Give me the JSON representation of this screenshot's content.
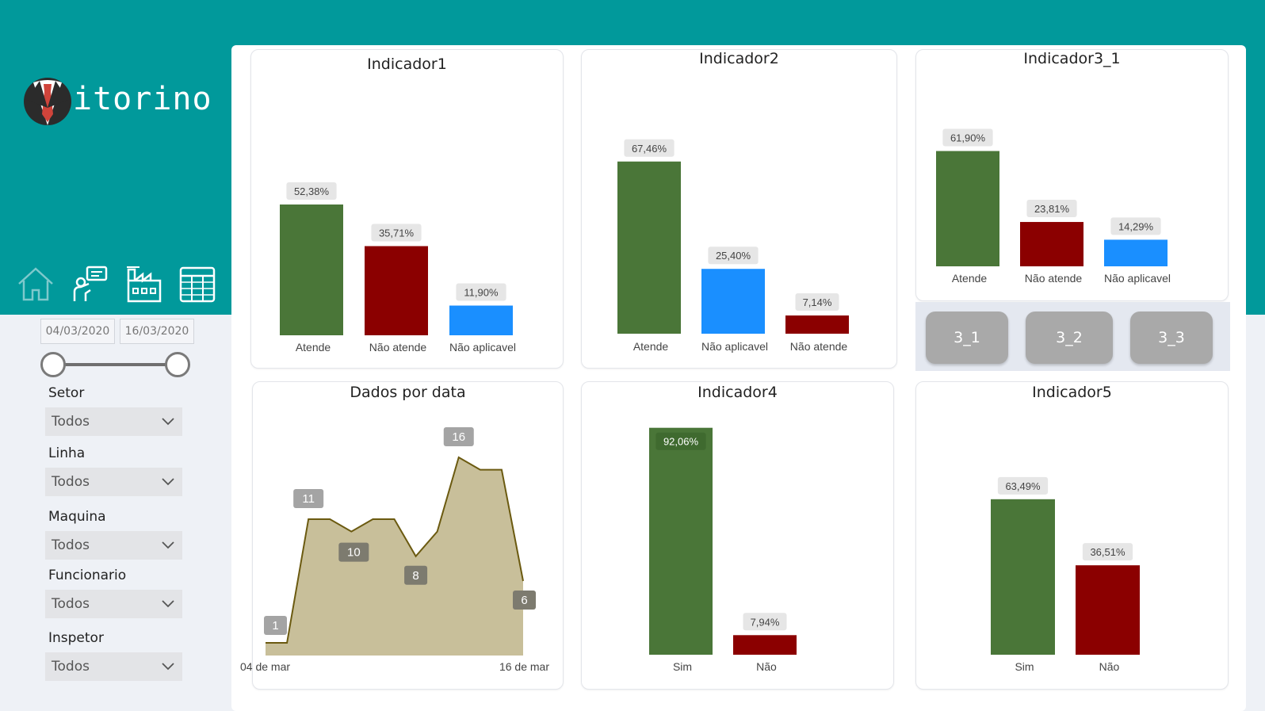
{
  "brand": {
    "name": "itorino"
  },
  "nav": [
    {
      "label": "home-icon"
    },
    {
      "label": "inspector-icon"
    },
    {
      "label": "factory-icon"
    },
    {
      "label": "table-icon"
    }
  ],
  "date_range": {
    "start": "04/03/2020",
    "end": "16/03/2020"
  },
  "filters": [
    {
      "label": "Setor",
      "value": "Todos"
    },
    {
      "label": "Linha",
      "value": "Todos"
    },
    {
      "label": "Maquina",
      "value": "Todos"
    },
    {
      "label": "Funcionario",
      "value": "Todos"
    },
    {
      "label": "Inspetor",
      "value": "Todos"
    }
  ],
  "colors": {
    "teal": "#01999b",
    "green": "#4a7638",
    "red": "#8b0000",
    "blue": "#1a8fff",
    "area_fill": "#c8bf9a",
    "area_line": "#6b5a10"
  },
  "sub_buttons": [
    "3_1",
    "3_2",
    "3_3"
  ],
  "chart_data": [
    {
      "type": "bar",
      "title": "Indicador1",
      "categories": [
        "Atende",
        "Não atende",
        "Não aplicavel"
      ],
      "values": [
        52.38,
        35.71,
        11.9
      ],
      "labels": [
        "52,38%",
        "35,71%",
        "11,90%"
      ],
      "colors": [
        "#4a7638",
        "#8b0000",
        "#1a8fff"
      ]
    },
    {
      "type": "bar",
      "title": "Indicador2",
      "categories": [
        "Atende",
        "Não aplicavel",
        "Não atende"
      ],
      "values": [
        67.46,
        25.4,
        7.14
      ],
      "labels": [
        "67,46%",
        "25,40%",
        "7,14%"
      ],
      "colors": [
        "#4a7638",
        "#1a8fff",
        "#8b0000"
      ]
    },
    {
      "type": "bar",
      "title": "Indicador3_1",
      "categories": [
        "Atende",
        "Não atende",
        "Não aplicavel"
      ],
      "values": [
        61.9,
        23.81,
        14.29
      ],
      "labels": [
        "61,90%",
        "23,81%",
        "14,29%"
      ],
      "colors": [
        "#4a7638",
        "#8b0000",
        "#1a8fff"
      ]
    },
    {
      "type": "area",
      "title": "Dados por data",
      "x_start_label": "04 de mar",
      "x_end_label": "16 de mar",
      "values": [
        1,
        1,
        11,
        11,
        10,
        11,
        11,
        8,
        10,
        16,
        15,
        15,
        6
      ],
      "data_labels": [
        {
          "index": 0,
          "text": "1"
        },
        {
          "index": 2,
          "text": "11"
        },
        {
          "index": 4,
          "text": "10"
        },
        {
          "index": 7,
          "text": "8"
        },
        {
          "index": 9,
          "text": "16"
        },
        {
          "index": 12,
          "text": "6"
        }
      ]
    },
    {
      "type": "bar",
      "title": "Indicador4",
      "categories": [
        "Sim",
        "Não"
      ],
      "values": [
        92.06,
        7.94
      ],
      "labels": [
        "92,06%",
        "7,94%"
      ],
      "colors": [
        "#4a7638",
        "#8b0000"
      ]
    },
    {
      "type": "bar",
      "title": "Indicador5",
      "categories": [
        "Sim",
        "Não"
      ],
      "values": [
        63.49,
        36.51
      ],
      "labels": [
        "63,49%",
        "36,51%"
      ],
      "colors": [
        "#4a7638",
        "#8b0000"
      ]
    }
  ]
}
